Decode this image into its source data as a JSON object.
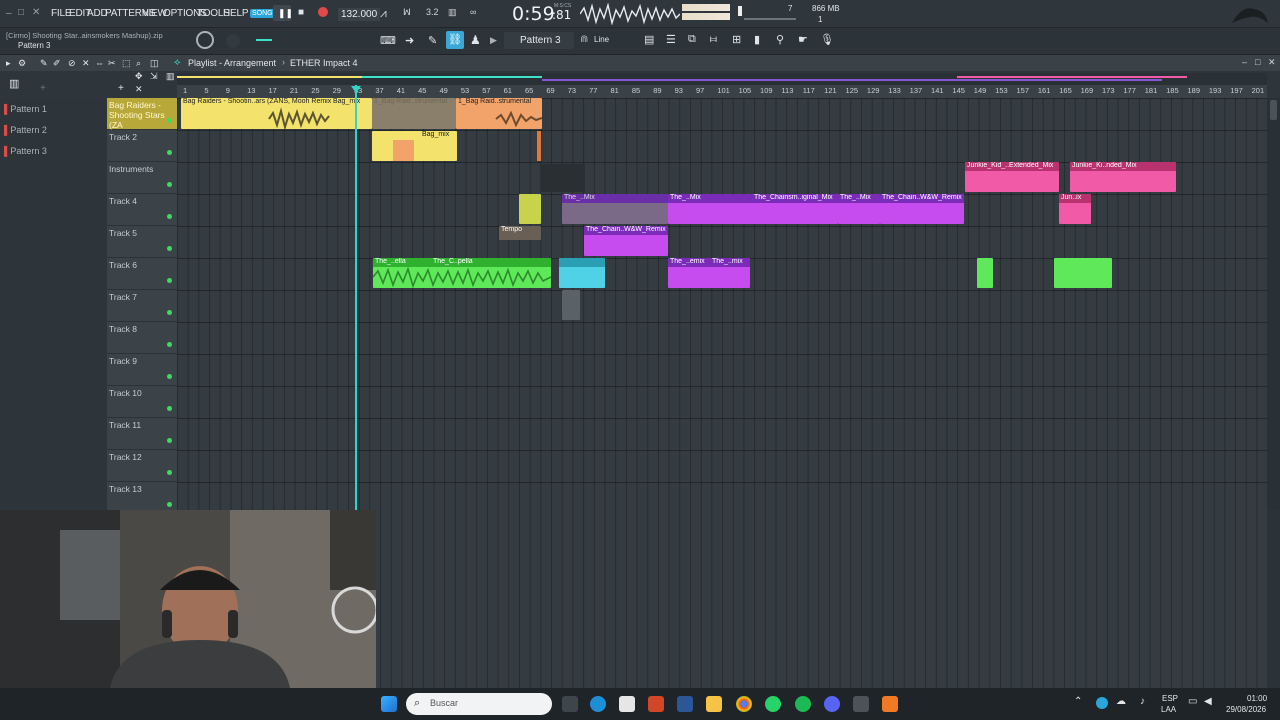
{
  "window": {
    "project_label": "[Cirmo] Shooting Star..ainsmokers Mashup).zip",
    "pattern_label": "Pattern 3"
  },
  "menu": [
    "FILE",
    "EDIT",
    "ADD",
    "PATTERNS",
    "VIEW",
    "OPTIONS",
    "TOOLS",
    "HELP"
  ],
  "transport": {
    "mode": "SONG",
    "tempo": "132.000",
    "time_main": "0:59",
    "time_sub": ":81",
    "time_label": "M:S:CS",
    "memory": "866 MB",
    "voices": "7",
    "cpu": "1",
    "snap_count": "3.2"
  },
  "toolbar": {
    "pattern": "Pattern 3",
    "snap": "Line"
  },
  "playlist": {
    "title": "Playlist - Arrangement",
    "separator": "›",
    "current_item": "ETHER Impact 4"
  },
  "picker": {
    "patterns": [
      "Pattern 1",
      "Pattern 2",
      "Pattern 3"
    ]
  },
  "tracks": [
    "Bag Raiders - Shooting Stars (ZA",
    "Track 2",
    "Instruments",
    "Track 4",
    "Track 5",
    "Track 6",
    "Track 7",
    "Track 8",
    "Track 9",
    "Track 10",
    "Track 11",
    "Track 12",
    "Track 13"
  ],
  "ruler": [
    "1",
    "5",
    "9",
    "13",
    "17",
    "21",
    "25",
    "29",
    "33",
    "37",
    "41",
    "45",
    "49",
    "53",
    "57",
    "61",
    "65",
    "69",
    "73",
    "77",
    "81",
    "85",
    "89",
    "93",
    "97",
    "101",
    "105",
    "109",
    "113",
    "117",
    "121",
    "125",
    "129",
    "133",
    "137",
    "141",
    "145",
    "149",
    "153",
    "157",
    "161",
    "165",
    "169",
    "173",
    "177",
    "181",
    "185",
    "189",
    "193",
    "197",
    "201"
  ],
  "clips": {
    "t1_a": "Bag Raiders - Shootin..ars (ZANS, Mooh Remix)",
    "t1_b": "Bag_mix",
    "t1_c": "1_Bag Raid..strumental",
    "t1_d": "1_Bag Raid..strumental",
    "t2_a": "Bag_mix",
    "t3_a": "Junkie_Kid_..Extended_Mix",
    "t3_b": "Junkie_Ki..nded_Mix",
    "t4_a": "The_..Mix",
    "t4_b": "The_..Mix",
    "t4_c": "The_Chainsm..iginal_Mix",
    "t4_d": "The_..Mix",
    "t4_e": "The_Chain..W&W_Remix",
    "t4_f": "Jun..ix",
    "t4_tempo": "Tempo",
    "t5_a": "The_Chain..W&W_Remix",
    "t6_a": "The_..ella",
    "t6_b": "The_C..pella",
    "t6_c": "The_..emix",
    "t6_d": "The_..mix"
  },
  "taskbar": {
    "search_placeholder": "Buscar",
    "lang1": "ESP",
    "lang2": "LAA",
    "time": "01:00",
    "date": "29/08/2026"
  },
  "colors": {
    "yellow": "#f3e36c",
    "orange": "#f2a36a",
    "pink": "#f15aa6",
    "purple": "#c64cf0",
    "green": "#5ee85a",
    "cyan": "#4fd2e6",
    "playhead": "#33d3c8"
  }
}
